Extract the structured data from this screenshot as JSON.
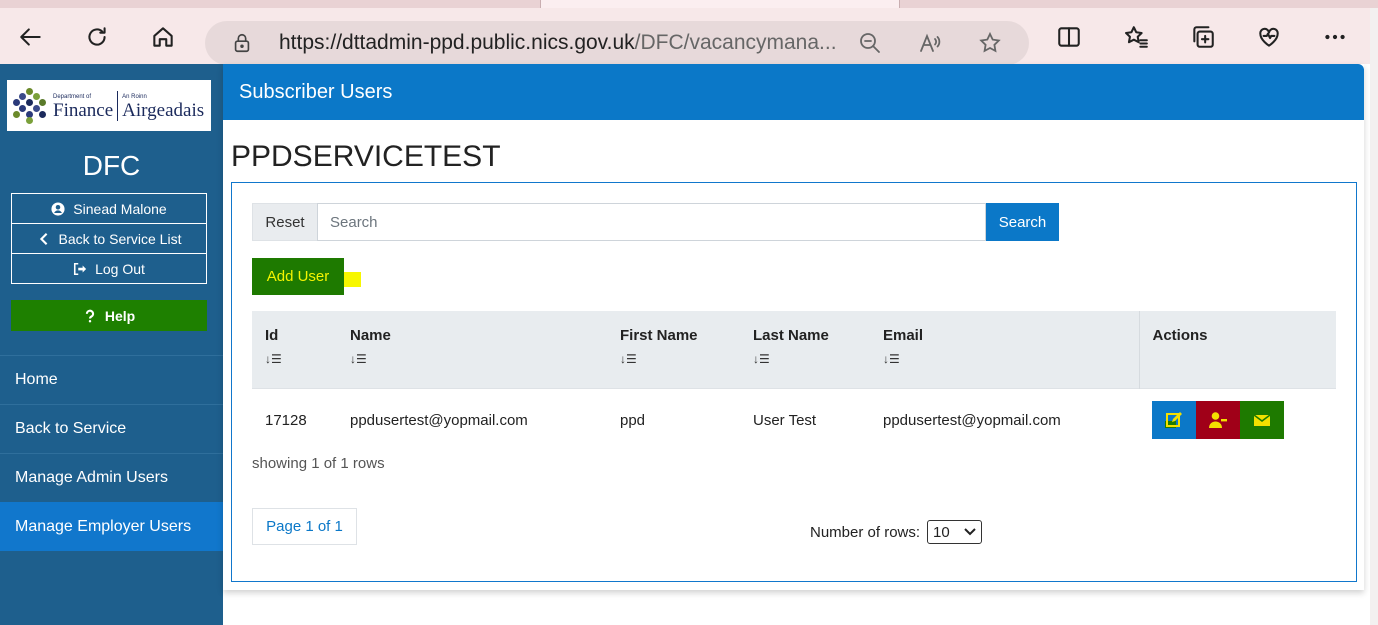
{
  "browser": {
    "url_host": "https://dttadmin-ppd.public.nics.gov.uk",
    "url_path": "/DFC/vacancymana..."
  },
  "sidebar": {
    "logo_dept_small": "Department of",
    "logo_dept_big": "Finance",
    "logo_irish_small": "An Roinn",
    "logo_irish_big": "Airgeadais",
    "title": "DFC",
    "user_label": "Sinead Malone",
    "back_label": "Back to Service List",
    "logout_label": "Log Out",
    "help_label": "Help",
    "nav": [
      {
        "label": "Home",
        "active": false
      },
      {
        "label": "Back to Service",
        "active": false
      },
      {
        "label": "Manage Admin Users",
        "active": false
      },
      {
        "label": "Manage Employer Users",
        "active": true
      }
    ]
  },
  "main": {
    "header": "Subscriber Users",
    "org_title": "PPDSERVICETEST",
    "reset_label": "Reset",
    "search_placeholder": "Search",
    "search_label": "Search",
    "add_user_label": "Add User",
    "columns": [
      "Id",
      "Name",
      "First Name",
      "Last Name",
      "Email",
      "Actions"
    ],
    "rows": [
      {
        "id": "17128",
        "name": "ppdusertest@yopmail.com",
        "first_name": "ppd",
        "last_name": "User Test",
        "email": "ppdusertest@yopmail.com"
      }
    ],
    "showing": "showing 1 of 1 rows",
    "pager": "Page 1 of 1",
    "rows_label": "Number of rows:",
    "rows_value": "10"
  },
  "colors": {
    "sidebar": "#1e5f8d",
    "primary": "#0b78c8",
    "green": "#1e7a00",
    "red_action": "#a00018",
    "highlight": "#f7f700"
  }
}
